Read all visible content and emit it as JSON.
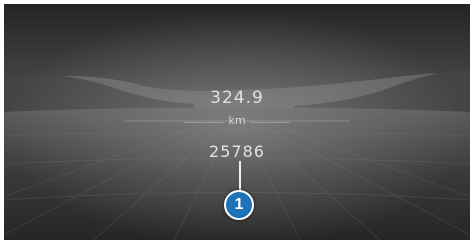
{
  "display": {
    "trip_distance": "324.9",
    "unit": "km",
    "total_distance": "25786"
  },
  "callout": {
    "number": "1",
    "color": "#1e72b8"
  }
}
